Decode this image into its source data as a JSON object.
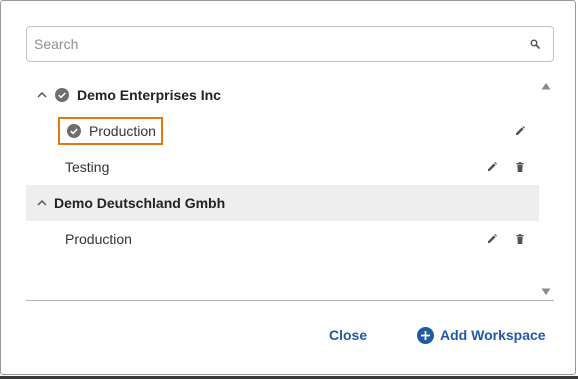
{
  "search": {
    "placeholder": "Search",
    "value": ""
  },
  "workspaces": {
    "groups": [
      {
        "name": "Demo Enterprises Inc",
        "expanded": true,
        "selected": true,
        "items": [
          {
            "name": "Production",
            "selected": true,
            "actions": [
              "edit"
            ]
          },
          {
            "name": "Testing",
            "selected": false,
            "actions": [
              "edit",
              "delete"
            ]
          }
        ]
      },
      {
        "name": "Demo Deutschland Gmbh",
        "expanded": true,
        "selected": false,
        "items": [
          {
            "name": "Production",
            "selected": false,
            "actions": [
              "edit",
              "delete"
            ]
          }
        ]
      }
    ]
  },
  "footer": {
    "close_label": "Close",
    "add_label": "Add Workspace"
  },
  "colors": {
    "accent": "#1f5aa8",
    "highlight": "#e07a10",
    "check": "#6e6e6e",
    "shaded_row": "#eeeeee"
  },
  "icons": {
    "search": "search-icon",
    "expand": "chevron-up-icon",
    "selected": "check-circle-icon",
    "edit": "pencil-icon",
    "delete": "trash-icon",
    "add": "plus-circle-icon",
    "scroll_up": "scroll-up-arrow-icon",
    "scroll_down": "scroll-down-arrow-icon"
  }
}
